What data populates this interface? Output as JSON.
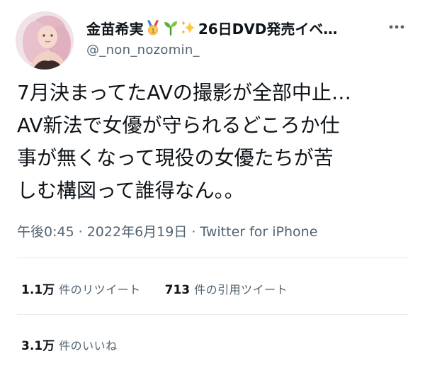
{
  "user": {
    "display_name": "金苗希実",
    "name_icons": [
      "medal-icon",
      "seedling-icon",
      "sparkles-icon"
    ],
    "display_name_suffix": "26日DVD発売イベ…",
    "handle": "@_non_nozomin_"
  },
  "tweet": {
    "lines": [
      "7月決まってたAVの撮影が全部中止…",
      "AV新法で女優が守られるどころか仕",
      "事が無くなって現役の女優たちが苦",
      "しむ構図って誰得なん。。"
    ]
  },
  "meta": {
    "time": "午後0:45",
    "separator": "·",
    "date": "2022年6月19日",
    "source": "Twitter for iPhone"
  },
  "stats": {
    "retweets": {
      "count": "1.1万",
      "label": "件のリツイート"
    },
    "quotes": {
      "count": "713",
      "label": "件の引用ツイート"
    },
    "likes": {
      "count": "3.1万",
      "label": "件のいいね"
    }
  },
  "colors": {
    "text": "#0f1419",
    "secondary": "#536471",
    "divider": "#e6e9ea",
    "medal_gold": "#f4b73f",
    "seedling_green": "#5fb236",
    "sparkle_yellow": "#ffc93c"
  }
}
